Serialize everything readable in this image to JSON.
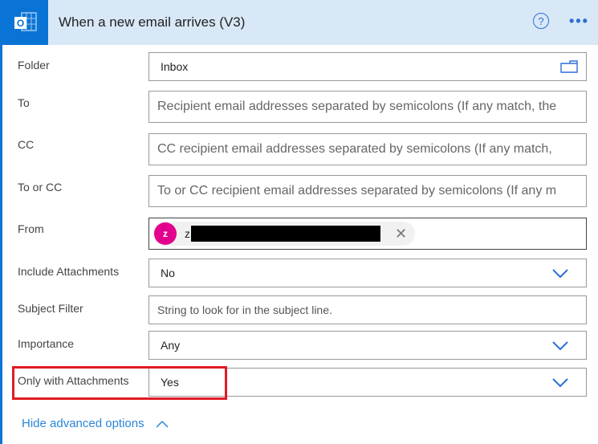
{
  "header": {
    "title": "When a new email arrives (V3)",
    "logo_icon": "outlook-icon",
    "help_icon": "help-icon",
    "more_icon": "more-options-icon",
    "more_glyph": "•••",
    "help_glyph": "?"
  },
  "fields": {
    "folder": {
      "label": "Folder",
      "value": "Inbox",
      "icon": "folder-icon"
    },
    "to": {
      "label": "To",
      "placeholder": "Recipient email addresses separated by semicolons (If any match, the"
    },
    "cc": {
      "label": "CC",
      "placeholder": "CC recipient email addresses separated by semicolons (If any match,"
    },
    "to_or_cc": {
      "label": "To or CC",
      "placeholder": "To or CC recipient email addresses separated by semicolons (If any m"
    },
    "from": {
      "label": "From",
      "chip": {
        "initial": "z",
        "text": "z",
        "remove_glyph": "✕"
      }
    },
    "include_attachments": {
      "label": "Include Attachments",
      "value": "No"
    },
    "subject_filter": {
      "label": "Subject Filter",
      "placeholder": "String to look for in the subject line."
    },
    "importance": {
      "label": "Importance",
      "value": "Any"
    },
    "only_with_attachments": {
      "label": "Only with Attachments",
      "value": "Yes"
    }
  },
  "advanced": {
    "label": "Hide advanced options"
  },
  "colors": {
    "accent": "#0a74d6",
    "header_bg": "#d9e8f7",
    "highlight": "#e01b24",
    "avatar": "#e3008c",
    "link": "#2a86d6"
  }
}
